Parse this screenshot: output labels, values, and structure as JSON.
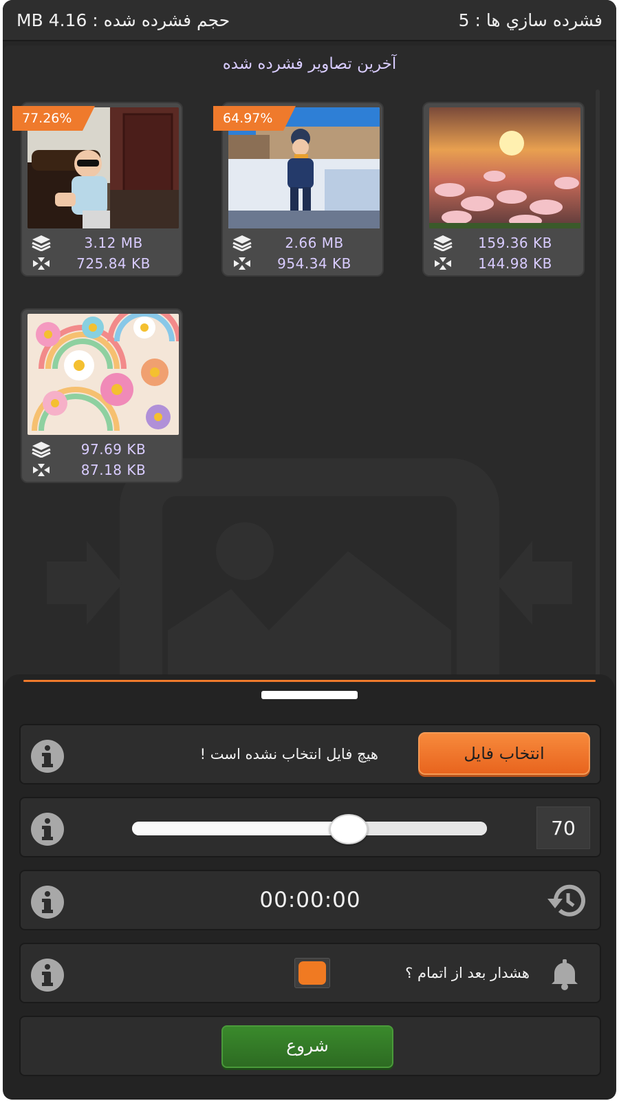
{
  "header": {
    "compressed_count_label": "فشرده سازي ها : 5",
    "compressed_size_label": "حجم فشرده شده : 4.16 MB"
  },
  "recent": {
    "title": "آخرين تصاوير فشرده شده",
    "items": [
      {
        "badge": "77.26%",
        "original": "3.12 MB",
        "compressed": "725.84 KB",
        "thumb": "child-with-sunglasses-photo"
      },
      {
        "badge": "64.97%",
        "original": "2.66 MB",
        "compressed": "954.34 KB",
        "thumb": "child-in-snow-photo"
      },
      {
        "badge": "",
        "original": "159.36 KB",
        "compressed": "144.98 KB",
        "thumb": "lily-flowers-sunset-photo"
      },
      {
        "badge": "",
        "original": "97.69 KB",
        "compressed": "87.18 KB",
        "thumb": "rainbow-daisies-pattern"
      }
    ]
  },
  "controls": {
    "select_file_label": "انتخاب فايل",
    "no_file_text": "هيچ فايل انتخاب نشده است !",
    "quality_value": "70",
    "quality_fraction": 0.61,
    "timer": "00:00:00",
    "alarm_label": "هشدار بعد از اتمام ؟",
    "alarm_checked": true,
    "start_label": "شروع"
  },
  "colors": {
    "accent": "#ef7a2c",
    "start_green": "#2d6b22",
    "value_text": "#d9ccff"
  }
}
